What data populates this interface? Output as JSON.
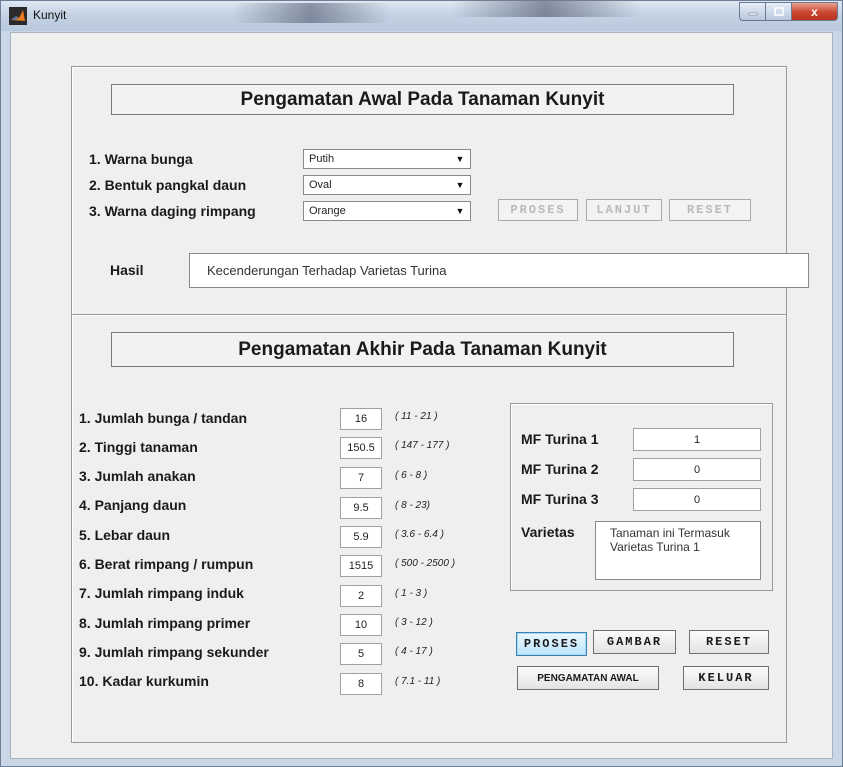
{
  "window": {
    "title": "Kunyit",
    "close_glyph": "x"
  },
  "awal": {
    "title": "Pengamatan Awal Pada Tanaman Kunyit",
    "fields": [
      {
        "label": "1. Warna bunga",
        "value": "Putih"
      },
      {
        "label": "2. Bentuk pangkal daun",
        "value": "Oval"
      },
      {
        "label": "3. Warna daging rimpang",
        "value": "Orange"
      }
    ],
    "buttons": {
      "proses": "PROSES",
      "lanjut": "LANJUT",
      "reset": "RESET"
    },
    "hasil_label": "Hasil",
    "hasil_value": "Kecenderungan Terhadap Varietas Turina"
  },
  "akhir": {
    "title": "Pengamatan Akhir Pada Tanaman Kunyit",
    "rows": [
      {
        "label": "1. Jumlah bunga / tandan",
        "value": "16",
        "range": "( 11 - 21 )"
      },
      {
        "label": "2. Tinggi tanaman",
        "value": "150.5",
        "range": "( 147 - 177 )"
      },
      {
        "label": "3. Jumlah anakan",
        "value": "7",
        "range": "( 6 - 8 )"
      },
      {
        "label": "4. Panjang daun",
        "value": "9.5",
        "range": "( 8 - 23)"
      },
      {
        "label": "5. Lebar daun",
        "value": "5.9",
        "range": "( 3.6 - 6.4 )"
      },
      {
        "label": "6. Berat rimpang / rumpun",
        "value": "1515",
        "range": "( 500 - 2500 )"
      },
      {
        "label": "7. Jumlah rimpang induk",
        "value": "2",
        "range": "( 1 - 3 )"
      },
      {
        "label": "8. Jumlah rimpang primer",
        "value": "10",
        "range": "( 3 - 12 )"
      },
      {
        "label": "9. Jumlah rimpang sekunder",
        "value": "5",
        "range": "( 4 - 17 )"
      },
      {
        "label": "10. Kadar kurkumin",
        "value": "8",
        "range": "( 7.1 - 11 )"
      }
    ],
    "mf": [
      {
        "label": "MF Turina 1",
        "value": "1"
      },
      {
        "label": "MF Turina 2",
        "value": "0"
      },
      {
        "label": "MF Turina 3",
        "value": "0"
      }
    ],
    "varietas_label": "Varietas",
    "varietas_value": "Tanaman ini Termasuk Varietas Turina 1",
    "buttons": {
      "proses": "PROSES",
      "gambar": "GAMBAR",
      "reset": "RESET",
      "pengamatan_awal": "PENGAMATAN AWAL",
      "keluar": "KELUAR"
    }
  },
  "icons": {
    "app": "matlab-logo-icon",
    "dropdown": "dropdown-arrow-icon"
  },
  "colors": {
    "active_button": "#bee6fd",
    "close_button": "#c9472e"
  }
}
